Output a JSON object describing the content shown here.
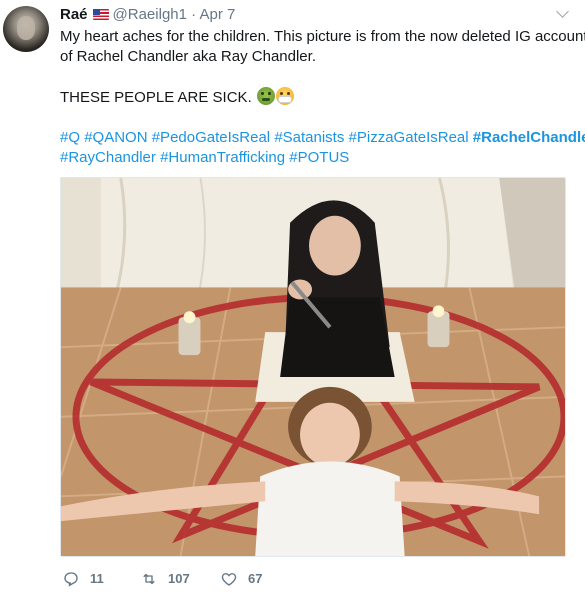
{
  "tweet": {
    "author": {
      "name": "Raé",
      "flag": "us-flag-icon",
      "handle": "@Raeilgh1",
      "separator": "·",
      "date": "Apr 7"
    },
    "text": {
      "line1": "My heart aches for the children. This picture is from the now deleted IG account",
      "line2": "of Rachel Chandler aka Ray Chandler.",
      "line3": "THESE PEOPLE ARE SICK.",
      "emoji1": "nauseated-face-emoji",
      "emoji2": "face-with-mask-emoji"
    },
    "hashtags_line1": [
      "#Q",
      "#QANON",
      "#PedoGateIsReal",
      "#Satanists",
      "#PizzaGateIsReal",
      "#RachelChandler"
    ],
    "hashtags_line2": [
      "#RayChandler",
      "#HumanTrafficking",
      "#POTUS"
    ],
    "actions": {
      "reply_count": "11",
      "retweet_count": "107",
      "like_count": "67"
    },
    "colors": {
      "link": "#1b95e0",
      "muted": "#657786",
      "text": "#14171a"
    },
    "icons": {
      "menu": "chevron-down-icon",
      "reply": "reply-icon",
      "retweet": "retweet-icon",
      "like": "heart-icon"
    }
  }
}
